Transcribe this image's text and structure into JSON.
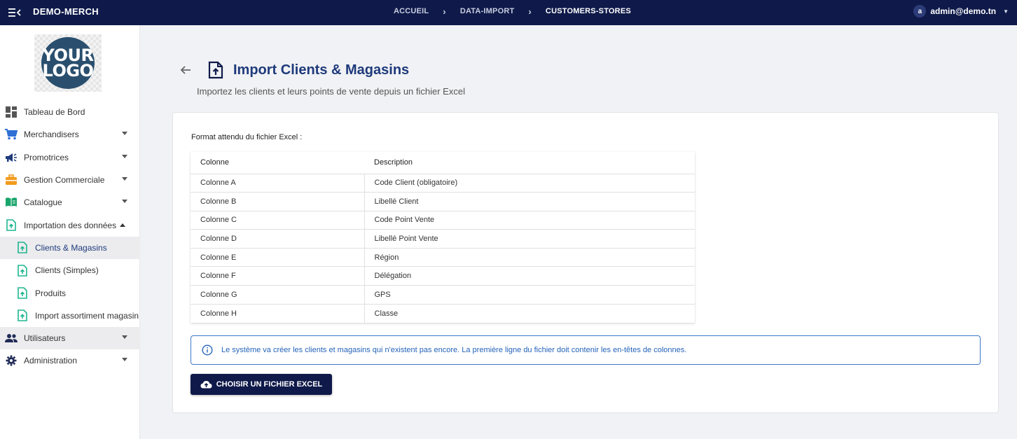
{
  "app": {
    "title": "DEMO-MERCH"
  },
  "breadcrumb": [
    {
      "label": "ACCUEIL"
    },
    {
      "label": "DATA-IMPORT"
    },
    {
      "label": "CUSTOMERS-STORES"
    }
  ],
  "user": {
    "initial": "a",
    "email": "admin@demo.tn"
  },
  "logo": {
    "line1": "YOUR",
    "line2": "LOGO"
  },
  "sidebar": {
    "items": [
      {
        "label": "Tableau de Bord",
        "icon": "dashboard-icon"
      },
      {
        "label": "Merchandisers",
        "icon": "cart-icon"
      },
      {
        "label": "Promotrices",
        "icon": "megaphone-icon"
      },
      {
        "label": "Gestion Commerciale",
        "icon": "briefcase-icon"
      },
      {
        "label": "Catalogue",
        "icon": "book-icon"
      },
      {
        "label": "Importation des données",
        "icon": "file-upload-icon"
      },
      {
        "label": "Clients & Magasins",
        "icon": "file-upload-icon"
      },
      {
        "label": "Clients (Simples)",
        "icon": "file-upload-icon"
      },
      {
        "label": "Produits",
        "icon": "file-upload-icon"
      },
      {
        "label": "Import assortiment magasin",
        "icon": "file-upload-icon"
      },
      {
        "label": "Utilisateurs",
        "icon": "users-icon"
      },
      {
        "label": "Administration",
        "icon": "gear-icon"
      }
    ]
  },
  "page": {
    "title": "Import Clients & Magasins",
    "subtitle": "Importez les clients et leurs points de vente depuis un fichier Excel",
    "format_label": "Format attendu du fichier Excel :",
    "table": {
      "headers": [
        "Colonne",
        "Description"
      ],
      "rows": [
        [
          "Colonne A",
          "Code Client (obligatoire)"
        ],
        [
          "Colonne B",
          "Libellé Client"
        ],
        [
          "Colonne C",
          "Code Point Vente"
        ],
        [
          "Colonne D",
          "Libellé Point Vente"
        ],
        [
          "Colonne E",
          "Région"
        ],
        [
          "Colonne F",
          "Délégation"
        ],
        [
          "Colonne G",
          "GPS"
        ],
        [
          "Colonne H",
          "Classe"
        ]
      ]
    },
    "info": "Le système va créer les clients et magasins qui n'existent pas encore. La première ligne du fichier doit contenir les en-têtes de colonnes.",
    "upload_button": "CHOISIR UN FICHIER EXCEL"
  },
  "colors": {
    "primary": "#0f1a4a",
    "title": "#1e3a7b",
    "accent_green": "#1fb58f",
    "info_blue": "#2563b8"
  }
}
